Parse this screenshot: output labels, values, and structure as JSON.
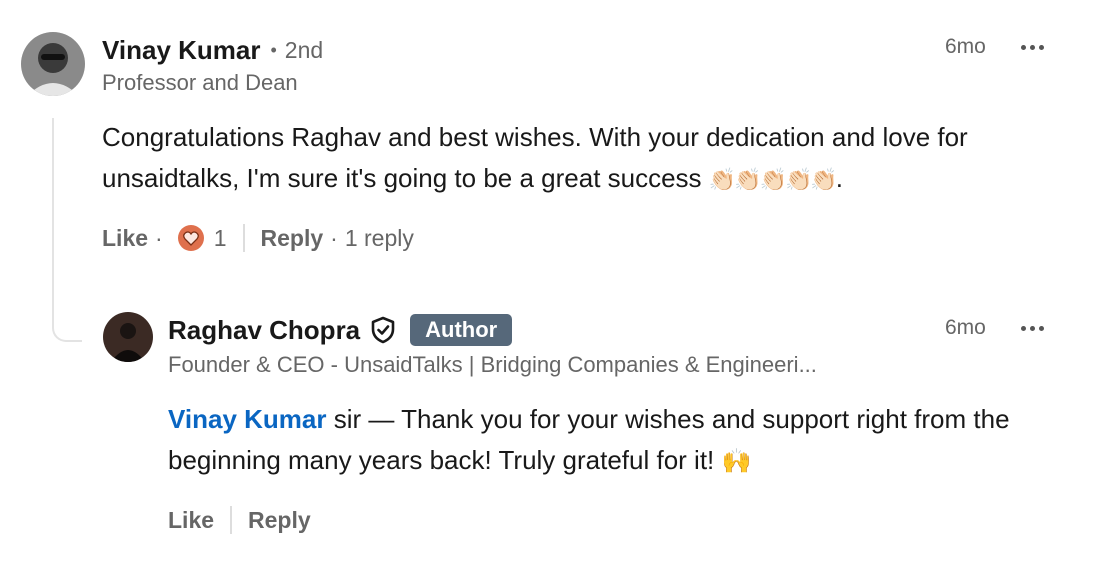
{
  "comment": {
    "author_name": "Vinay Kumar",
    "connection_separator": "•",
    "degree": "2nd",
    "headline": "Professor and Dean",
    "time": "6mo",
    "text_part1": "Congratulations Raghav and best wishes. With your dedication and love for unsaidtalks, I'm sure it's going to be a great success",
    "text_emoji": "👏🏻👏🏻👏🏻👏🏻👏🏻",
    "text_end": ".",
    "like_label": "Like",
    "reaction_count": "1",
    "reply_label": "Reply",
    "replies_count_label": "1 reply",
    "dot": "·"
  },
  "reply": {
    "author_name": "Raghav Chopra",
    "badge": "Author",
    "headline": "Founder & CEO - UnsaidTalks | Bridging Companies & Engineeri...",
    "time": "6mo",
    "mention": "Vinay Kumar",
    "text": " sir — Thank you for your wishes and support right from the beginning many years back! Truly grateful for it!",
    "text_emoji": "🙌",
    "like_label": "Like",
    "reply_label": "Reply"
  },
  "colors": {
    "mention": "#0a66c2",
    "author_badge_bg": "#56687a",
    "heart_reaction": "#df704d"
  },
  "icons": {
    "more": "ellipsis-icon",
    "verified": "shield-check-icon",
    "reaction": "heart-reaction-icon"
  }
}
